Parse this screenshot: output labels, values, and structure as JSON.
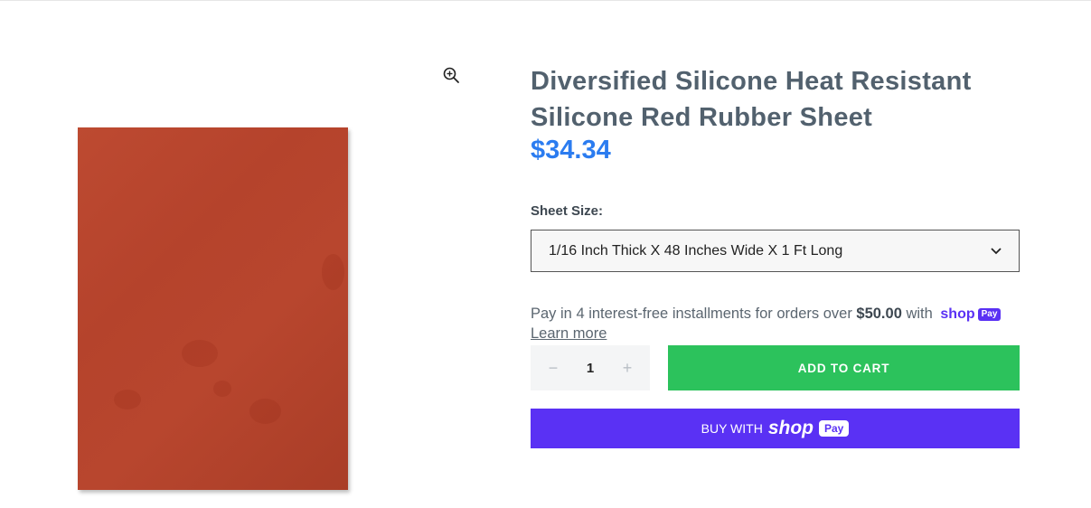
{
  "product": {
    "title": "Diversified Silicone Heat Resistant Silicone Red Rubber Sheet",
    "price": "$34.34",
    "image_icon": "zoom-in-icon"
  },
  "variant": {
    "label": "Sheet Size:",
    "selected": "1/16 Inch Thick X 48 Inches Wide X 1 Ft Long"
  },
  "installments": {
    "prefix": "Pay in 4 interest-free installments for orders over ",
    "threshold": "$50.00",
    "suffix": " with ",
    "brand_shop": "shop",
    "brand_pay": "Pay",
    "learn_more": "Learn more"
  },
  "quantity": {
    "value": "1",
    "minus": "−",
    "plus": "+"
  },
  "buttons": {
    "add_to_cart": "ADD TO CART",
    "buy_with": "BUY WITH",
    "shop": "shop",
    "pay": "Pay"
  },
  "colors": {
    "accent_price": "#2b7cf0",
    "add_to_cart": "#2cc25c",
    "shop_pay": "#5a31f4",
    "product_sheet": "#b8462e"
  }
}
